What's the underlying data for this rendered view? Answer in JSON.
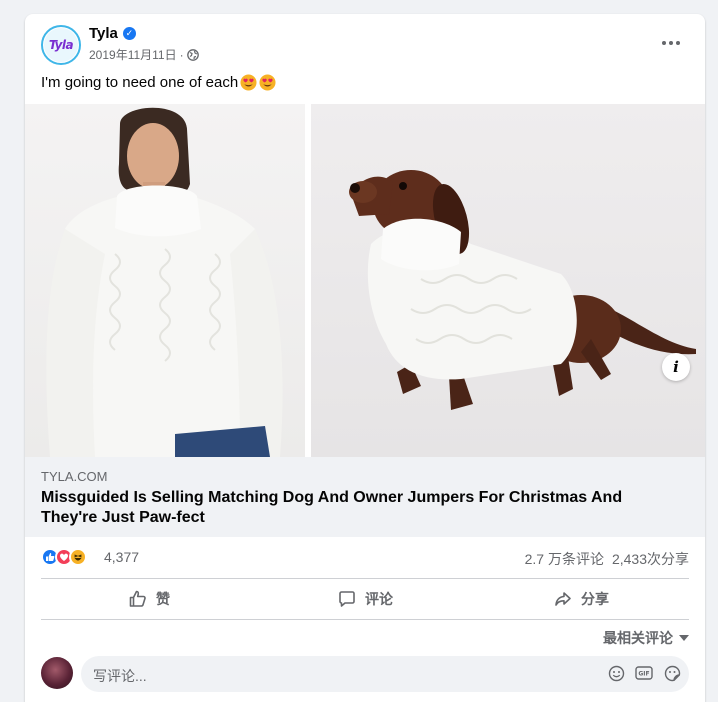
{
  "post": {
    "author": "Tyla",
    "avatar_text": "Tyla",
    "date": "2019年11月11日",
    "separator": "·",
    "text": "I'm going to need one of each",
    "emoji": "heart-eyes"
  },
  "link": {
    "domain": "TYLA.COM",
    "title": "Missguided Is Selling Matching Dog And Owner Jumpers For Christmas And They're Just Paw-fect"
  },
  "stats": {
    "reaction_count": "4,377",
    "comments": "2.7 万条评论",
    "shares": "2,433次分享"
  },
  "actions": {
    "like": "赞",
    "comment": "评论",
    "share": "分享"
  },
  "sort_label": "最相关评论",
  "comment_placeholder": "写评论...",
  "colors": {
    "brand": "#1877f2",
    "love": "#f33e58",
    "haha": "#f7b125",
    "muted_text": "#65676b"
  }
}
